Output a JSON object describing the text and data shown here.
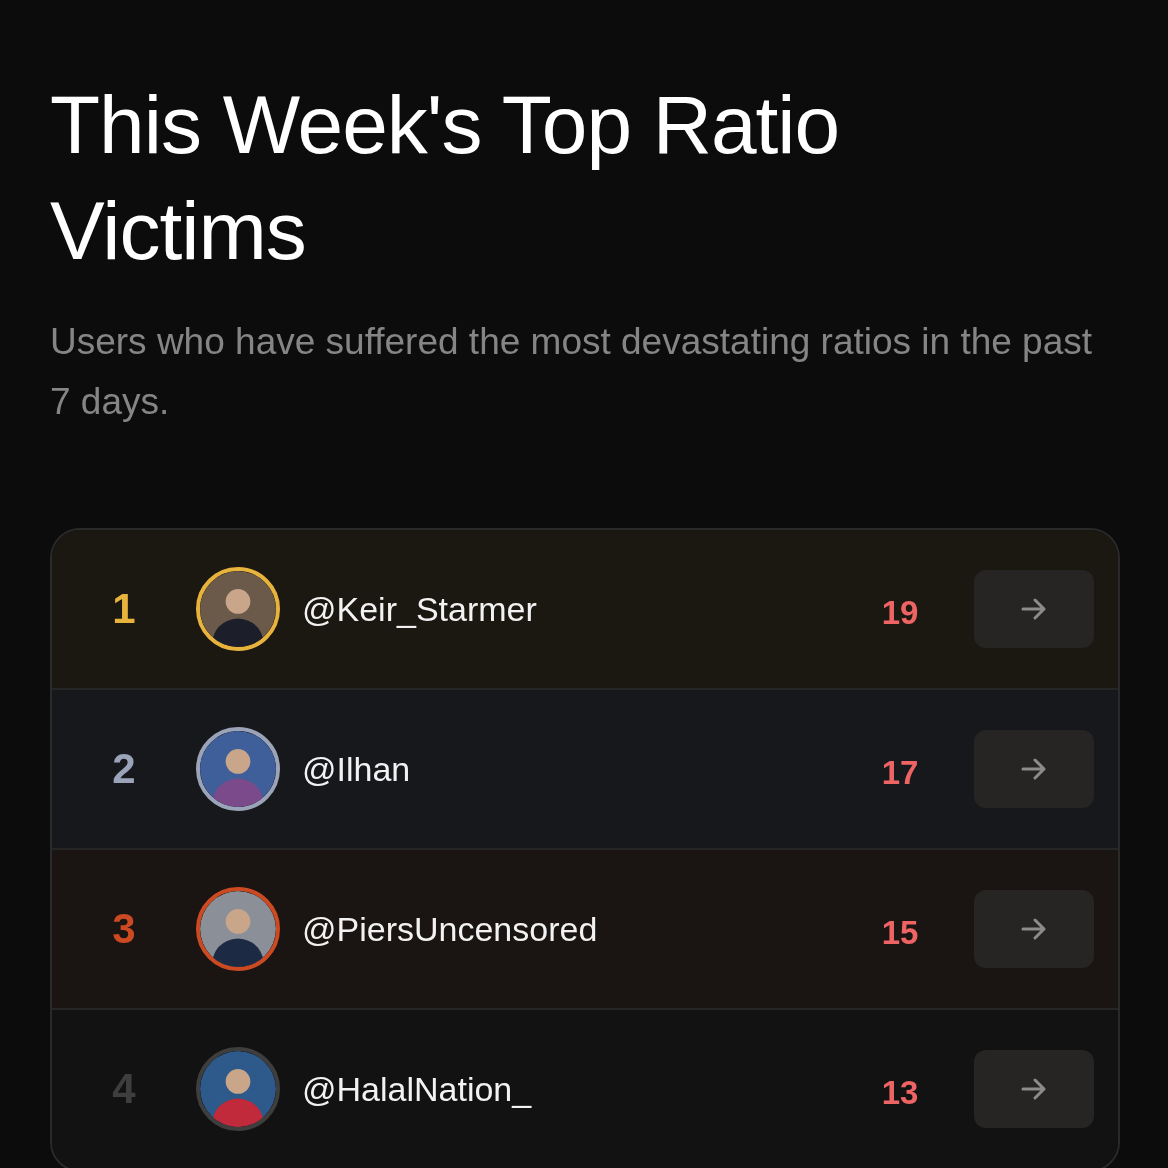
{
  "title": "This Week's Top Ratio Victims",
  "subtitle": "Users who have suffered the most devastating ratios in the past 7 days.",
  "leaderboard": [
    {
      "rank": "1",
      "kind": "gold",
      "color": "#e8b33c",
      "handle": "@Keir_Starmer",
      "count": "19"
    },
    {
      "rank": "2",
      "kind": "silver",
      "color": "#9aa3b8",
      "handle": "@Ilhan",
      "count": "17"
    },
    {
      "rank": "3",
      "kind": "bronze",
      "color": "#cc4a22",
      "handle": "@PiersUncensored",
      "count": "15"
    },
    {
      "rank": "4",
      "kind": "plain",
      "color": "#3e3e3e",
      "handle": "@HalalNation_",
      "count": "13"
    }
  ]
}
